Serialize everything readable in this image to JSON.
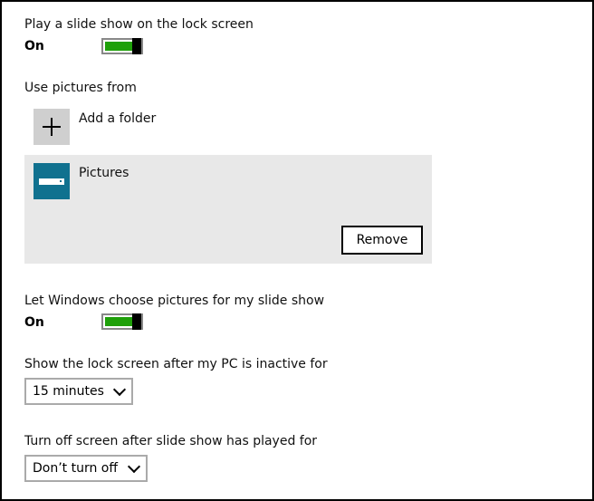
{
  "slideshow": {
    "title": "Play a slide show on the lock screen",
    "state": "On"
  },
  "pictures": {
    "heading": "Use pictures from",
    "add_folder_label": "Add a folder",
    "folder_name": "Pictures",
    "remove_label": "Remove"
  },
  "windows_choose": {
    "title": "Let Windows choose pictures for my slide show",
    "state": "On"
  },
  "inactive": {
    "title": "Show the lock screen after my PC is inactive for",
    "value": "15 minutes"
  },
  "turn_off": {
    "title": "Turn off screen after slide show has played for",
    "value": "Don’t turn off"
  },
  "colors": {
    "toggle_on": "#1fa00a",
    "folder_tile": "#10718f",
    "selected_row": "#e8e8e8"
  }
}
